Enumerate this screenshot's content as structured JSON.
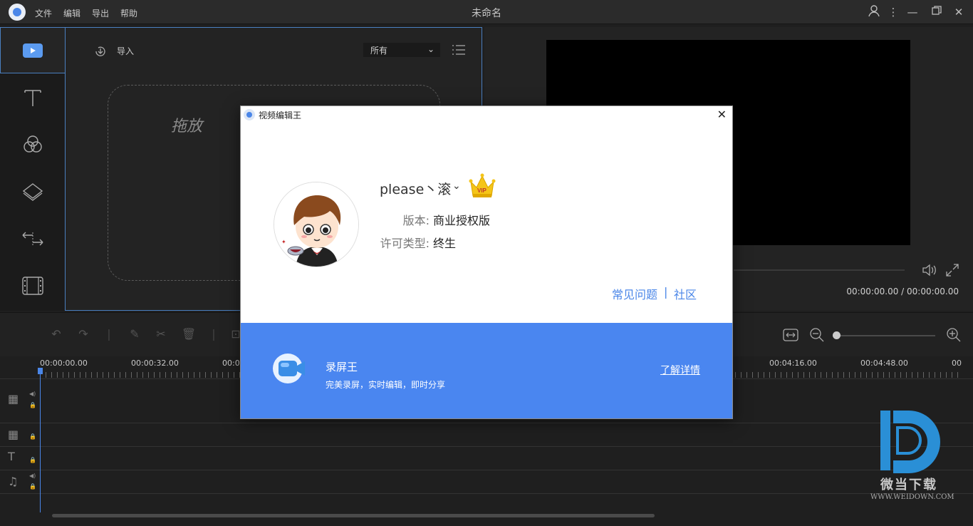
{
  "window": {
    "title": "未命名",
    "menu": [
      "文件",
      "编辑",
      "导出",
      "帮助"
    ]
  },
  "media": {
    "import_label": "导入",
    "filter_value": "所有",
    "drop_hint": "拖放"
  },
  "preview": {
    "time": "00:00:00.00 / 00:00:00.00"
  },
  "timeline": {
    "ticks": [
      "00:00:00.00",
      "00:00:32.00",
      "00:01",
      "00:04:16.00",
      "00:04:48.00",
      "00"
    ]
  },
  "dialog": {
    "title": "视频编辑王",
    "username": "please丶滚",
    "vip_badge": "VIP",
    "version_label": "版本:",
    "version_value": "商业授权版",
    "license_label": "许可类型:",
    "license_value": "终生",
    "faq_link": "常见问题",
    "separator": "|",
    "community_link": "社区",
    "promo": {
      "title": "录屏王",
      "subtitle": "完美录屏，实时编辑，即时分享",
      "link": "了解详情"
    }
  },
  "watermark": {
    "text": "微当下载",
    "url": "WWW.WEIDOWN.COM"
  },
  "colors": {
    "accent": "#4a86e8",
    "promo_bg": "#4a86f0",
    "panel_bg": "#232323"
  }
}
